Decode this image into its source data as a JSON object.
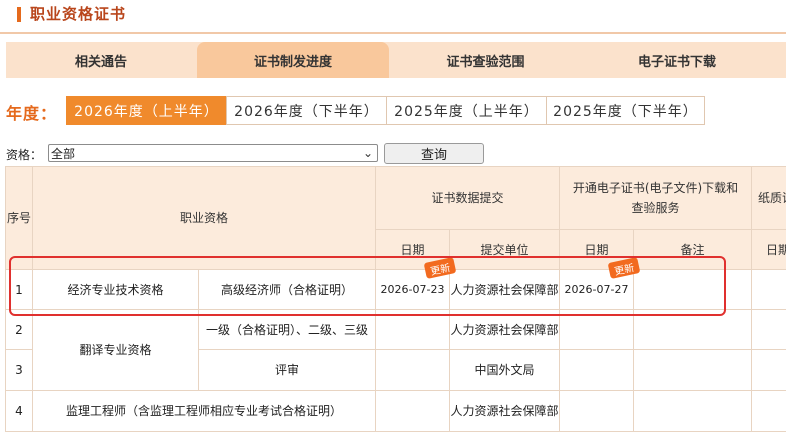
{
  "header": {
    "title": "职业资格证书"
  },
  "tabs": [
    {
      "label": "相关通告"
    },
    {
      "label": "证书制发进度"
    },
    {
      "label": "证书查验范围"
    },
    {
      "label": "电子证书下载"
    }
  ],
  "year_filter": {
    "label": "年度：",
    "options": [
      "2026年度（上半年）",
      "2026年度（下半年）",
      "2025年度（上半年）",
      "2025年度（下半年）"
    ],
    "selected": "2026年度（上半年）"
  },
  "qualification_filter": {
    "label": "资格：",
    "selected": "全部",
    "query_button": "查询"
  },
  "table": {
    "headers": {
      "index": "序号",
      "qualification": "职业资格",
      "submission": "证书数据提交",
      "electronic": "开通电子证书(电子文件)下载和查验服务",
      "paper": "纸质证",
      "date": "日期",
      "submit_unit": "提交单位",
      "remark": "备注",
      "paper_date": "日期"
    },
    "rows": [
      {
        "index": "1",
        "category": "经济专业技术资格",
        "level": "高级经济师（合格证明）",
        "submit_date": "2026-07-23",
        "submit_unit": "人力资源社会保障部",
        "electronic_date": "2026-07-27",
        "remark": "",
        "submit_badge": "更新",
        "electronic_badge": "更新"
      },
      {
        "index": "2",
        "category": "翻译专业资格",
        "level": "一级（合格证明）、二级、三级",
        "submit_date": "",
        "submit_unit": "人力资源社会保障部",
        "electronic_date": "",
        "remark": ""
      },
      {
        "index": "3",
        "category": "",
        "level": "评审",
        "submit_date": "",
        "submit_unit": "中国外文局",
        "electronic_date": "",
        "remark": ""
      },
      {
        "index": "4",
        "category": "监理工程师（含监理工程师相应专业考试合格证明）",
        "level": "",
        "submit_date": "",
        "submit_unit": "人力资源社会保障部",
        "electronic_date": "",
        "remark": ""
      }
    ]
  }
}
